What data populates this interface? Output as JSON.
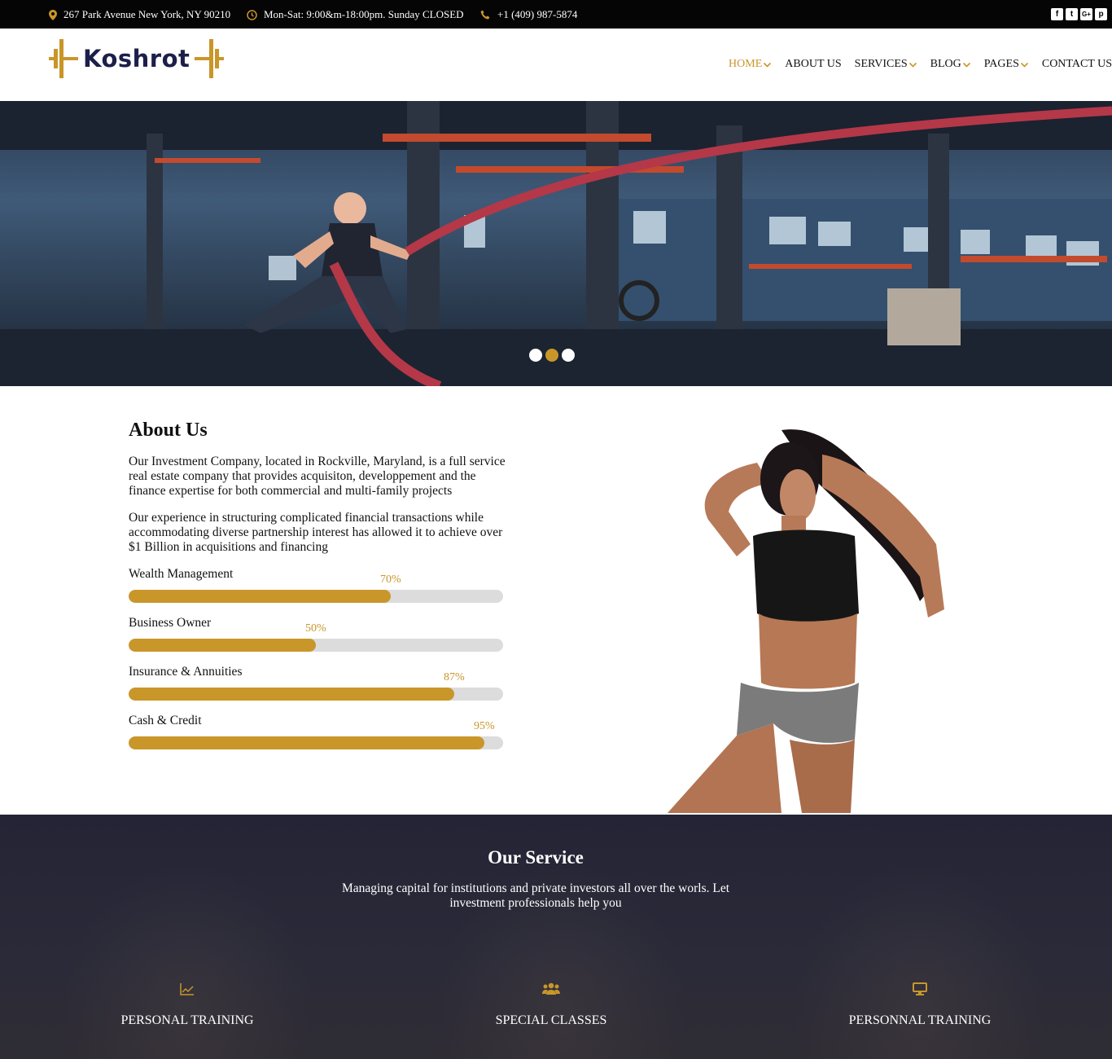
{
  "topbar": {
    "address": "267 Park Avenue New York, NY 90210",
    "hours": "Mon-Sat: 9:00&m-18:00pm. Sunday CLOSED",
    "phone": "+1 (409) 987-5874",
    "social": [
      "f",
      "t",
      "G+",
      "p"
    ]
  },
  "header": {
    "logo_text": "Koshrot",
    "nav": [
      {
        "label": "HOME",
        "dropdown": true,
        "active": true
      },
      {
        "label": "ABOUT US",
        "dropdown": false,
        "active": false
      },
      {
        "label": "SERVICES",
        "dropdown": true,
        "active": false
      },
      {
        "label": "BLOG",
        "dropdown": true,
        "active": false
      },
      {
        "label": "PAGES",
        "dropdown": true,
        "active": false
      },
      {
        "label": "CONTACT US",
        "dropdown": false,
        "active": false
      }
    ]
  },
  "hero": {
    "slides": 3,
    "active_slide": 2
  },
  "about": {
    "title": "About Us",
    "paragraph1": "Our Investment Company, located in Rockville, Maryland, is a full service real estate company that provides acquisiton, developpement and the finance expertise for both commercial and multi-family projects",
    "paragraph2": "Our experience in structuring complicated financial transactions while accommodating diverse partnership interest has allowed it to achieve over $1 Billion in acquisitions and financing",
    "skills": [
      {
        "label": "Wealth Management",
        "percent_text": "70%",
        "value": 70
      },
      {
        "label": "Business Owner",
        "percent_text": "50%",
        "value": 50
      },
      {
        "label": "Insurance & Annuities",
        "percent_text": "87%",
        "value": 87
      },
      {
        "label": "Cash & Credit",
        "percent_text": "95%",
        "value": 95
      }
    ]
  },
  "services": {
    "title": "Our Service",
    "subtitle": "Managing capital for institutions and private investors all over the worls. Let investment professionals help you",
    "items": [
      {
        "label": "PERSONAL TRAINING",
        "icon": "line-chart-icon"
      },
      {
        "label": "SPECIAL CLASSES",
        "icon": "users-icon"
      },
      {
        "label": "PERSONNAL TRAINING",
        "icon": "monitor-icon"
      }
    ]
  },
  "colors": {
    "accent": "#c9962a",
    "topbar_bg": "#050505",
    "logo_text": "#1c1f4a",
    "services_bg": "#232332",
    "bar_track": "#dcdcdc"
  }
}
